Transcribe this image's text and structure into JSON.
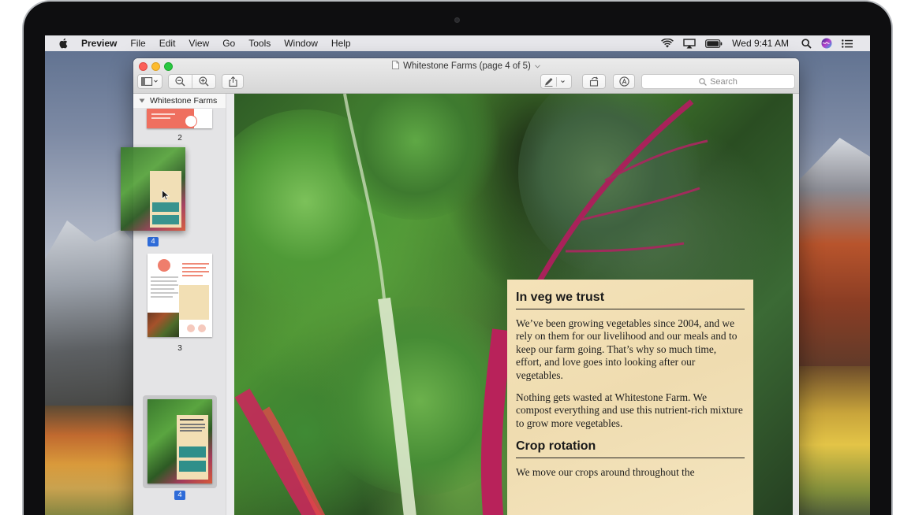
{
  "menubar": {
    "app": "Preview",
    "items": [
      "File",
      "Edit",
      "View",
      "Go",
      "Tools",
      "Window",
      "Help"
    ],
    "clock": "Wed 9:41 AM",
    "status_icons": [
      "wifi-icon",
      "airplay-icon",
      "battery-icon",
      "spotlight-icon",
      "siri-icon",
      "notification-center-icon"
    ]
  },
  "window": {
    "title": "Whitestone Farms (page 4 of 5)",
    "search_placeholder": "Search"
  },
  "sidebar": {
    "header": "Whitestone Farms",
    "thumbnails": [
      {
        "page": "2"
      },
      {
        "page": "4",
        "state": "dragging"
      },
      {
        "page": "3"
      },
      {
        "page": "4",
        "state": "selected"
      }
    ]
  },
  "document": {
    "sections": [
      {
        "heading": "In veg we trust",
        "paragraphs": [
          "We’ve been growing vegetables since 2004, and we rely on them for our livelihood and our meals and to keep our farm going. That’s why so much time, effort, and love goes into looking after our vegetables.",
          "Nothing gets wasted at Whitestone Farm. We compost everything and use this nutrient-rich mixture to grow more vegetables."
        ]
      },
      {
        "heading": "Crop rotation",
        "paragraphs": [
          "We move our crops around throughout the"
        ]
      }
    ]
  },
  "colors": {
    "selection_blue": "#2e6bd8",
    "panel_bg": "#f2dfb4",
    "close": "#fc5f57",
    "minimize": "#fdbc2e",
    "maximize": "#28c840"
  }
}
